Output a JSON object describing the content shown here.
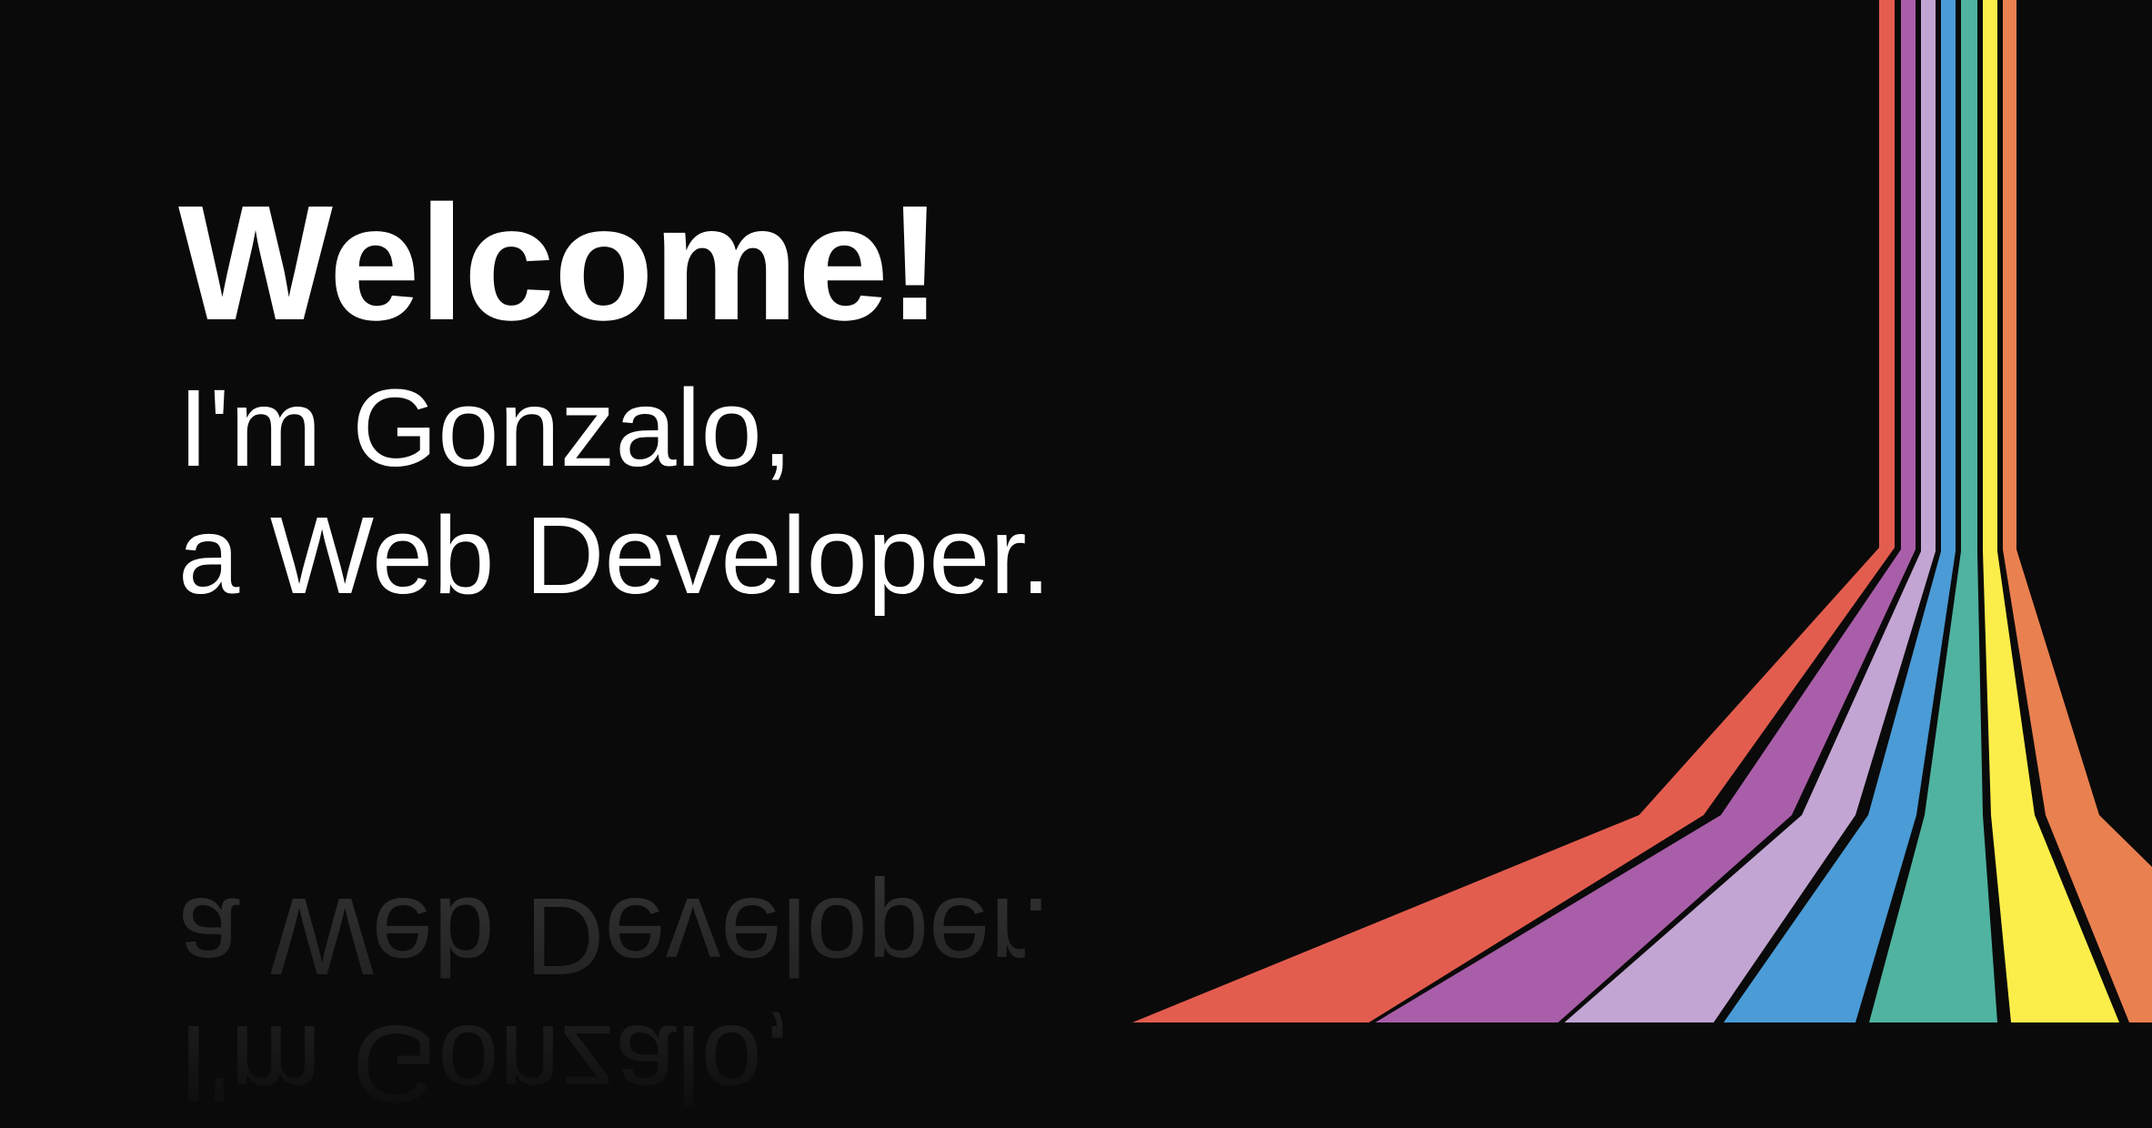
{
  "hero": {
    "title": "Welcome!",
    "line1": "I'm Gonzalo,",
    "line2": "a Web Developer."
  },
  "colors": {
    "background": "#0a0a0a",
    "text": "#ffffff",
    "stripes": [
      "#e35d4f",
      "#a95ea9",
      "#c2a5d2",
      "#4a9bd6",
      "#4fb3a0",
      "#fbee4a",
      "#e9804f"
    ]
  }
}
